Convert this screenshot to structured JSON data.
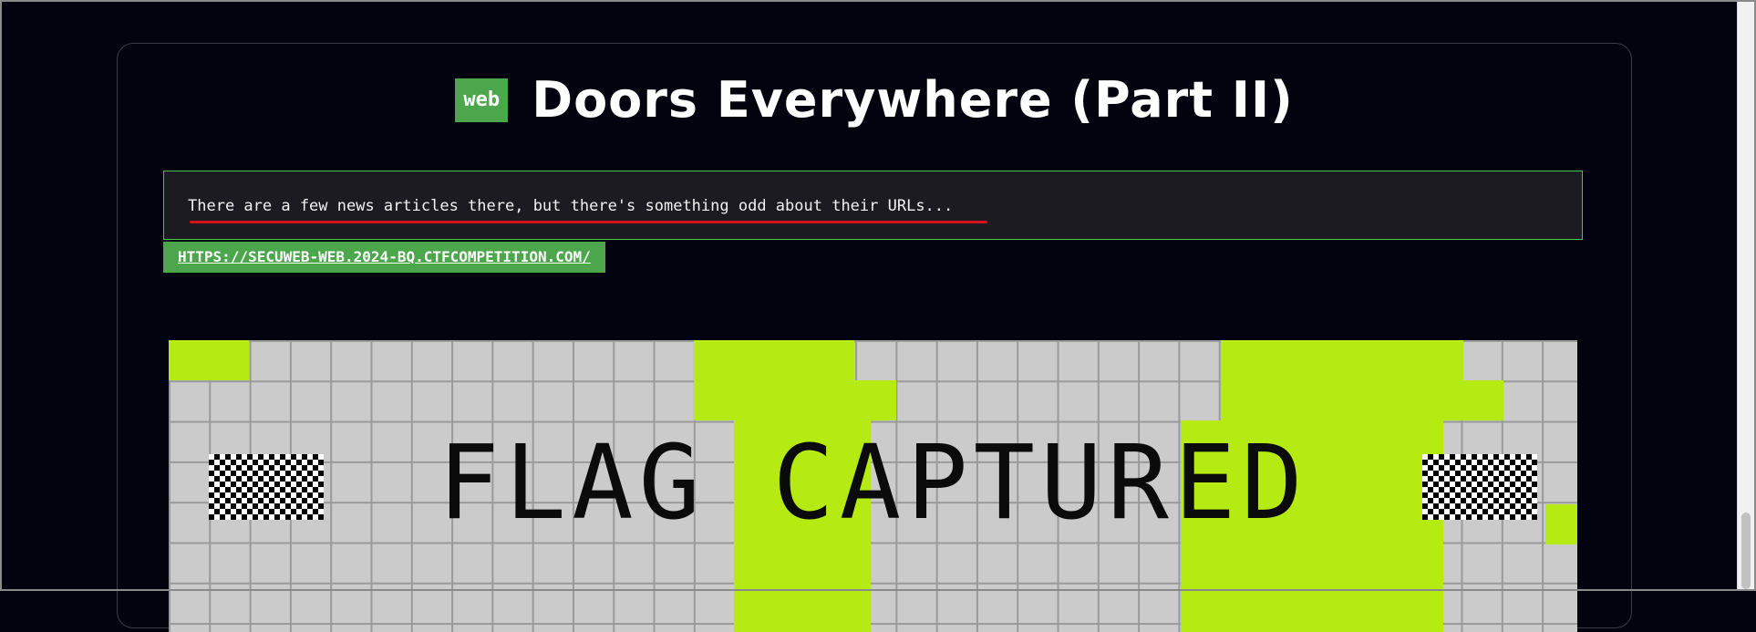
{
  "challenge": {
    "category_badge": "web",
    "title": "Doors Everywhere (Part II)",
    "description": "There are a few news articles there, but there's something odd about their URLs...",
    "url": "HTTPS://SECUWEB-WEB.2024-BQ.CTFCOMPETITION.COM/",
    "image": {
      "text": "FLAG CAPTURED",
      "colors": {
        "grid": "#cbcbcb",
        "accent": "#b5ea12"
      }
    }
  },
  "colors": {
    "background": "#03030f",
    "badge": "#4ca64c",
    "description_border": "#4ec24e",
    "underline": "#d4121a"
  }
}
